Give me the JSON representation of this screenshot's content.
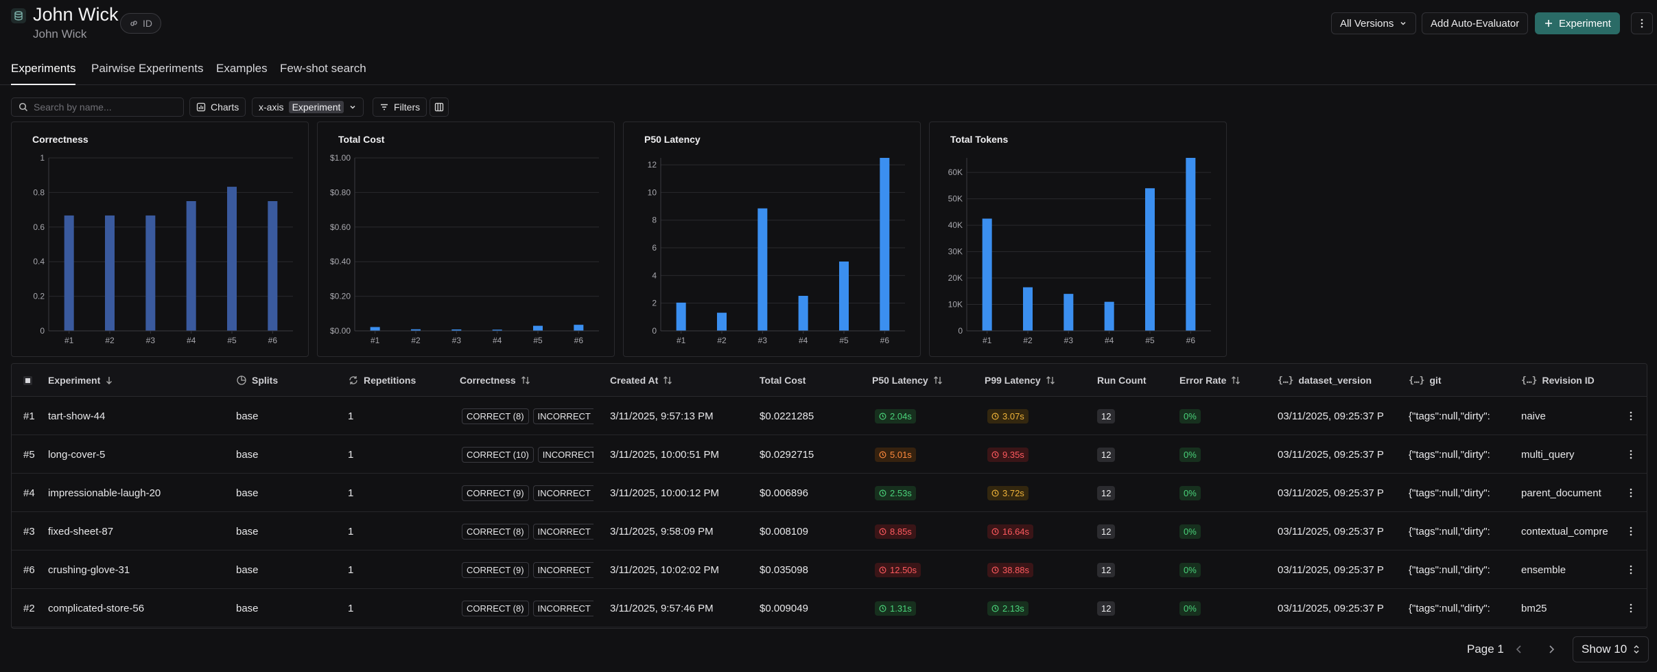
{
  "header": {
    "title": "John Wick",
    "subtitle": "John Wick",
    "id_label": "ID",
    "versions_label": "All Versions",
    "add_evaluator_label": "Add Auto-Evaluator",
    "experiment_label": "Experiment"
  },
  "tabs": [
    {
      "label": "Experiments",
      "active": true
    },
    {
      "label": "Pairwise Experiments",
      "active": false
    },
    {
      "label": "Examples",
      "active": false
    },
    {
      "label": "Few-shot search",
      "active": false
    }
  ],
  "toolbar": {
    "search_placeholder": "Search by name...",
    "charts_label": "Charts",
    "xaxis_label": "x-axis",
    "xaxis_value": "Experiment",
    "filters_label": "Filters"
  },
  "colors": {
    "accent": "#2a6b66",
    "bar_correctness": "#3a5a9e",
    "bar_default": "#3b8ff0"
  },
  "chart_data": [
    {
      "type": "bar",
      "title": "Correctness",
      "categories": [
        "#1",
        "#2",
        "#3",
        "#4",
        "#5",
        "#6"
      ],
      "values": [
        0.667,
        0.667,
        0.667,
        0.75,
        0.833,
        0.75
      ],
      "ylim": [
        0,
        1
      ],
      "yticks": [
        0,
        0.2,
        0.4,
        0.6,
        0.8,
        1
      ],
      "ytick_labels": [
        "0",
        "0.2",
        "0.4",
        "0.6",
        "0.8",
        "1"
      ],
      "grid": true
    },
    {
      "type": "bar",
      "title": "Total Cost",
      "categories": [
        "#1",
        "#2",
        "#3",
        "#4",
        "#5",
        "#6"
      ],
      "values": [
        0.0221,
        0.009,
        0.0081,
        0.0069,
        0.0293,
        0.0351
      ],
      "ylim": [
        0,
        1
      ],
      "yticks": [
        0,
        0.2,
        0.4,
        0.6,
        0.8,
        1
      ],
      "ytick_labels": [
        "$0.00",
        "$0.20",
        "$0.40",
        "$0.60",
        "$0.80",
        "$1.00"
      ],
      "grid": true
    },
    {
      "type": "bar",
      "title": "P50 Latency",
      "categories": [
        "#1",
        "#2",
        "#3",
        "#4",
        "#5",
        "#6"
      ],
      "values": [
        2.04,
        1.31,
        8.85,
        2.53,
        5.01,
        12.5
      ],
      "ylim": [
        0,
        12.5
      ],
      "yticks": [
        0,
        2,
        4,
        6,
        8,
        10,
        12
      ],
      "ytick_labels": [
        "0",
        "2",
        "4",
        "6",
        "8",
        "10",
        "12"
      ],
      "grid": true
    },
    {
      "type": "bar",
      "title": "Total Tokens",
      "categories": [
        "#1",
        "#2",
        "#3",
        "#4",
        "#5",
        "#6"
      ],
      "values": [
        42500,
        16500,
        14000,
        11000,
        54000,
        65500
      ],
      "ylim": [
        0,
        65500
      ],
      "yticks": [
        0,
        10000,
        20000,
        30000,
        40000,
        50000,
        60000
      ],
      "ytick_labels": [
        "0",
        "10K",
        "20K",
        "30K",
        "40K",
        "50K",
        "60K"
      ],
      "grid": true
    }
  ],
  "table": {
    "headers": {
      "experiment": "Experiment",
      "splits": "Splits",
      "repetitions": "Repetitions",
      "correctness": "Correctness",
      "created_at": "Created At",
      "total_cost": "Total Cost",
      "p50": "P50 Latency",
      "p99": "P99 Latency",
      "run_count": "Run Count",
      "error_rate": "Error Rate",
      "dataset_version": "dataset_version",
      "git": "git",
      "revision_id": "Revision ID"
    },
    "rows": [
      {
        "num": "#1",
        "name": "tart-show-44",
        "split": "base",
        "reps": "1",
        "correct": "CORRECT (8)",
        "incorrect": "INCORRECT",
        "created": "3/11/2025, 9:57:13 PM",
        "cost": "$0.0221285",
        "p50": "2.04s",
        "p50_level": "green",
        "p99": "3.07s",
        "p99_level": "yellow",
        "runs": "12",
        "error_rate": "0%",
        "dataset_version": "03/11/2025, 09:25:37 P",
        "git": "{\"tags\":null,\"dirty\":",
        "revision": "naive"
      },
      {
        "num": "#5",
        "name": "long-cover-5",
        "split": "base",
        "reps": "1",
        "correct": "CORRECT (10)",
        "incorrect": "INCORRECT",
        "created": "3/11/2025, 10:00:51 PM",
        "cost": "$0.0292715",
        "p50": "5.01s",
        "p50_level": "orange",
        "p99": "9.35s",
        "p99_level": "red",
        "runs": "12",
        "error_rate": "0%",
        "dataset_version": "03/11/2025, 09:25:37 P",
        "git": "{\"tags\":null,\"dirty\":",
        "revision": "multi_query"
      },
      {
        "num": "#4",
        "name": "impressionable-laugh-20",
        "split": "base",
        "reps": "1",
        "correct": "CORRECT (9)",
        "incorrect": "INCORRECT",
        "created": "3/11/2025, 10:00:12 PM",
        "cost": "$0.006896",
        "p50": "2.53s",
        "p50_level": "green",
        "p99": "3.72s",
        "p99_level": "yellow",
        "runs": "12",
        "error_rate": "0%",
        "dataset_version": "03/11/2025, 09:25:37 P",
        "git": "{\"tags\":null,\"dirty\":",
        "revision": "parent_document"
      },
      {
        "num": "#3",
        "name": "fixed-sheet-87",
        "split": "base",
        "reps": "1",
        "correct": "CORRECT (8)",
        "incorrect": "INCORRECT",
        "created": "3/11/2025, 9:58:09 PM",
        "cost": "$0.008109",
        "p50": "8.85s",
        "p50_level": "red",
        "p99": "16.64s",
        "p99_level": "red",
        "runs": "12",
        "error_rate": "0%",
        "dataset_version": "03/11/2025, 09:25:37 P",
        "git": "{\"tags\":null,\"dirty\":",
        "revision": "contextual_compre"
      },
      {
        "num": "#6",
        "name": "crushing-glove-31",
        "split": "base",
        "reps": "1",
        "correct": "CORRECT (9)",
        "incorrect": "INCORRECT",
        "created": "3/11/2025, 10:02:02 PM",
        "cost": "$0.035098",
        "p50": "12.50s",
        "p50_level": "red",
        "p99": "38.88s",
        "p99_level": "red",
        "runs": "12",
        "error_rate": "0%",
        "dataset_version": "03/11/2025, 09:25:37 P",
        "git": "{\"tags\":null,\"dirty\":",
        "revision": "ensemble"
      },
      {
        "num": "#2",
        "name": "complicated-store-56",
        "split": "base",
        "reps": "1",
        "correct": "CORRECT (8)",
        "incorrect": "INCORRECT",
        "created": "3/11/2025, 9:57:46 PM",
        "cost": "$0.009049",
        "p50": "1.31s",
        "p50_level": "green",
        "p99": "2.13s",
        "p99_level": "green",
        "runs": "12",
        "error_rate": "0%",
        "dataset_version": "03/11/2025, 09:25:37 P",
        "git": "{\"tags\":null,\"dirty\":",
        "revision": "bm25"
      }
    ]
  },
  "pagination": {
    "page_label": "Page 1",
    "show_label": "Show 10"
  }
}
